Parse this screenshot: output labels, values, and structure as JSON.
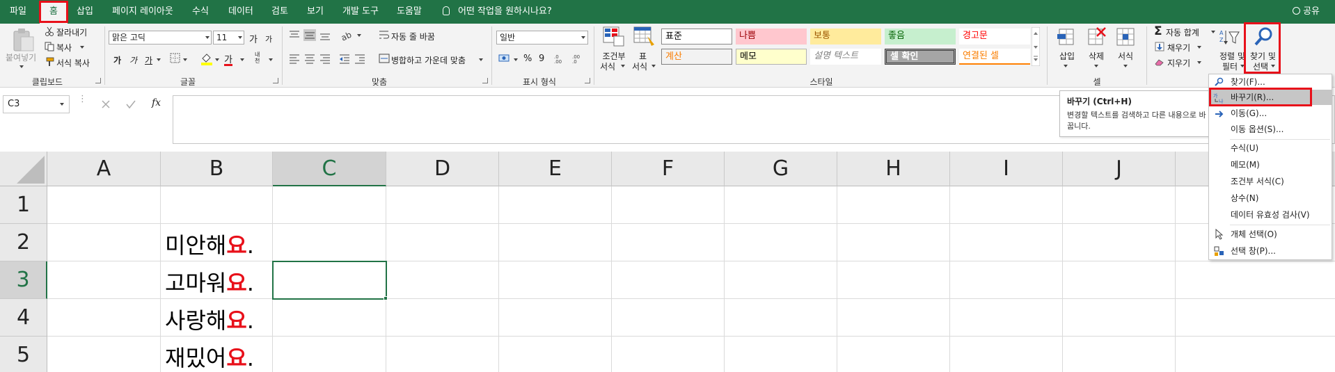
{
  "menubar": {
    "tabs": [
      "파일",
      "홈",
      "삽입",
      "페이지 레이아웃",
      "수식",
      "데이터",
      "검토",
      "보기",
      "개발 도구",
      "도움말"
    ],
    "tell_me": "어떤 작업을 원하시나요?",
    "share": "공유"
  },
  "ribbon": {
    "clipboard": {
      "paste": "붙여넣기",
      "cut": "잘라내기",
      "copy": "복사",
      "format_painter": "서식 복사",
      "label": "클립보드"
    },
    "font": {
      "name": "맑은 고딕",
      "size": "11",
      "grow": "가",
      "shrink": "가",
      "bold": "가",
      "italic": "가",
      "underline": "가",
      "font_color_glyph": "가",
      "phonetic": "내천",
      "label": "글꼴"
    },
    "alignment": {
      "wrap_text": "자동 줄 바꿈",
      "merge_center": "병합하고 가운데 맞춤",
      "label": "맞춤"
    },
    "number": {
      "format": "일반",
      "percent": "%",
      "comma": "9",
      "label": "표시 형식"
    },
    "styles": {
      "conditional": [
        "조건부",
        "서식"
      ],
      "table": [
        "표",
        "서식"
      ],
      "cells": [
        "표준",
        "나쁨",
        "보통",
        "좋음",
        "경고문",
        "계산",
        "메모",
        "설명 텍스트",
        "셀 확인",
        "연결된 셀"
      ],
      "label": "스타일"
    },
    "cells": {
      "insert": "삽입",
      "delete": "삭제",
      "format": "서식",
      "label": "셀"
    },
    "editing": {
      "autosum": "자동 합계",
      "fill": "채우기",
      "clear": "지우기",
      "sort_filter": [
        "정렬 및",
        "필터"
      ],
      "find_select": [
        "찾기 및",
        "선택"
      ]
    }
  },
  "formula_bar": {
    "name_box": "C3",
    "fx": "fx",
    "value": ""
  },
  "grid": {
    "columns": [
      "A",
      "B",
      "C",
      "D",
      "E",
      "F",
      "G",
      "H",
      "I",
      "J"
    ],
    "rows": [
      "1",
      "2",
      "3",
      "4",
      "5"
    ],
    "cells_b": [
      {
        "row": "2",
        "text": "미안해",
        "red": "요",
        "tail": "."
      },
      {
        "row": "3",
        "text": "고마워",
        "red": "요",
        "tail": "."
      },
      {
        "row": "4",
        "text": "사랑해",
        "red": "요",
        "tail": "."
      },
      {
        "row": "5",
        "text": "재밌어",
        "red": "요",
        "tail": "."
      }
    ],
    "selected_cell": "C3"
  },
  "tooltip": {
    "title": "바꾸기 (Ctrl+H)",
    "body": "변경할 텍스트를 검색하고 다른 내용으로 바꿉니다."
  },
  "find_menu": {
    "items": [
      "찾기(F)...",
      "바꾸기(R)...",
      "이동(G)...",
      "이동 옵션(S)...",
      "수식(U)",
      "메모(M)",
      "조건부 서식(C)",
      "상수(N)",
      "데이터 유효성 검사(V)",
      "개체 선택(O)",
      "선택 창(P)..."
    ],
    "highlighted": "바꾸기(R)..."
  },
  "colors": {
    "excel_green": "#217346",
    "highlight_red": "#e8101a",
    "ribbon_bg": "#f3f3f3"
  }
}
